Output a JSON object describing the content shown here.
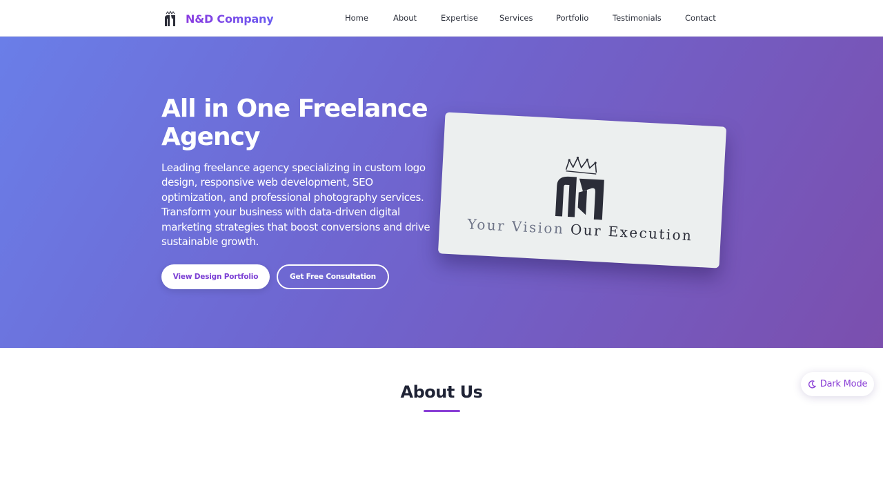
{
  "header": {
    "brand": "N&D Company",
    "nav": [
      {
        "label": "Home"
      },
      {
        "label": "About"
      },
      {
        "label": "Expertise"
      },
      {
        "label": "Services"
      },
      {
        "label": "Portfolio"
      },
      {
        "label": "Testimonials"
      },
      {
        "label": "Contact"
      }
    ]
  },
  "hero": {
    "title": "All in One Freelance Agency",
    "description": "Leading freelance agency specializing in custom logo design, responsive web development, SEO optimization, and professional photography services. Transform your business with data-driven digital marketing strategies that boost conversions and drive sustainable growth.",
    "primary_button": "View Design Portfolio",
    "secondary_button": "Get Free Consultation",
    "card": {
      "tagline_light": "Your Vision",
      "tagline_dark": "Our Execution"
    }
  },
  "about": {
    "title": "About Us"
  },
  "theme_toggle": {
    "label": "Dark Mode",
    "icon": "moon-icon"
  },
  "colors": {
    "accent": "#8a3fd6",
    "hero_gradient_start": "#6a7ee8",
    "hero_gradient_end": "#7b4fae",
    "heading": "#1f2335"
  }
}
